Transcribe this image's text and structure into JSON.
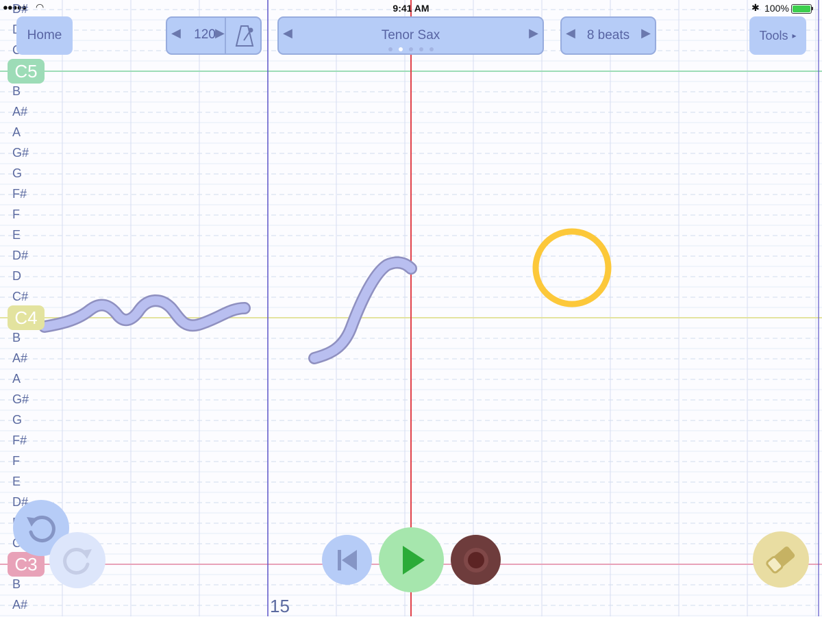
{
  "status_bar": {
    "time": "9:41 AM",
    "battery": "100%",
    "battery_level": 1.0
  },
  "toolbar": {
    "home_label": "Home",
    "tempo_value": "120",
    "metronome_icon": "metronome-icon",
    "instrument_label": "Tenor Sax",
    "instrument_page": 2,
    "instrument_page_count": 5,
    "length_label": "8 beats",
    "tools_label": "Tools",
    "tools_arrow": "▸"
  },
  "staff": {
    "top_notes": [
      "D#",
      "D",
      "C#"
    ],
    "upper_notes": [
      "B",
      "A#",
      "A",
      "G#",
      "G",
      "F#",
      "F",
      "E",
      "D#",
      "D",
      "C#"
    ],
    "lower_notes": [
      "B",
      "A#",
      "A",
      "G#",
      "G",
      "F#",
      "F",
      "E",
      "D#",
      "D",
      "C#"
    ],
    "bottom_notes": [
      "B",
      "A#"
    ],
    "c5_label": "C5",
    "c4_label": "C4",
    "c3_label": "C3",
    "c5_color": "#9ddcb7",
    "c4_color": "#e3e39f",
    "c3_color": "#e8a2b8"
  },
  "measure_number": "15",
  "colors": {
    "note_stroke": "#b9bff0",
    "playhead": "#e0414a",
    "target_circle": "#fcc83a",
    "play": "#2bab38",
    "record": "#6e3c3c"
  },
  "controls": {
    "undo_icon": "undo-icon",
    "redo_icon": "redo-icon",
    "rewind_icon": "rewind-icon",
    "play_icon": "play-icon",
    "record_icon": "record-icon",
    "eraser_icon": "eraser-icon"
  }
}
